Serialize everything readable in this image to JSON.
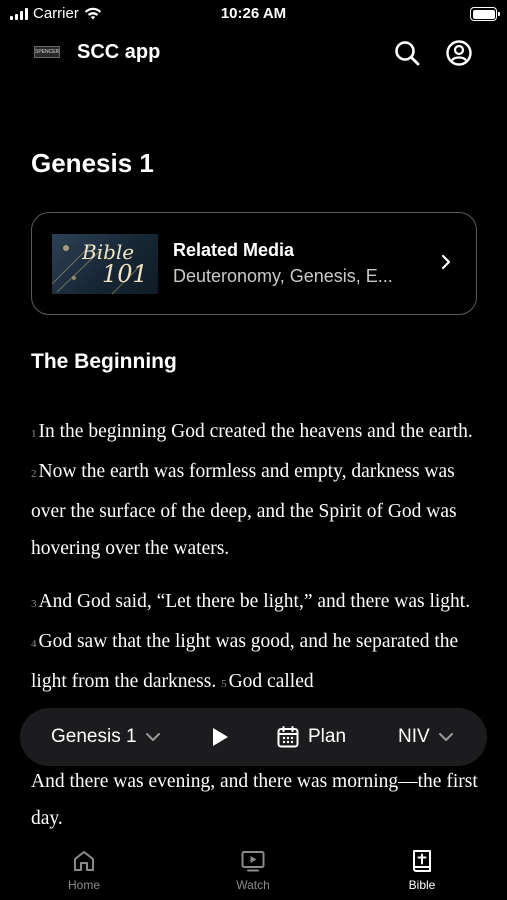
{
  "status_bar": {
    "carrier": "Carrier",
    "time": "10:26 AM"
  },
  "header": {
    "logo_text": "SPENCER",
    "app_title": "SCC app",
    "icons": [
      "search-icon",
      "profile-icon"
    ]
  },
  "page": {
    "title": "Genesis 1"
  },
  "related_media": {
    "title": "Related Media",
    "subtitle": "Deuteronomy, Genesis, E...",
    "thumbnail_text_1": "Bible",
    "thumbnail_text_2": "101"
  },
  "section": {
    "heading": "The Beginning"
  },
  "scripture": {
    "paragraphs": [
      [
        {
          "num": "1",
          "text": "In the beginning God created the heavens and the earth."
        },
        {
          "num": "2",
          "text": "Now the earth was formless and empty, darkness was over the surface of the deep, and the Spirit of God was hovering over the waters."
        }
      ],
      [
        {
          "num": "3",
          "text": "And God said, “Let there be light,” and there was light."
        },
        {
          "num": "4",
          "text": "God saw that the light was good, and he separated the light from the darkness."
        },
        {
          "num": "5",
          "text": "God called"
        }
      ]
    ],
    "tail": "And there was evening, and there was morning—the first day."
  },
  "reader_bar": {
    "chapter": "Genesis 1",
    "plan_label": "Plan",
    "version": "NIV"
  },
  "tabs": [
    {
      "label": "Home",
      "icon": "home-icon",
      "active": false
    },
    {
      "label": "Watch",
      "icon": "tv-icon",
      "active": false
    },
    {
      "label": "Bible",
      "icon": "bible-icon",
      "active": true
    }
  ]
}
